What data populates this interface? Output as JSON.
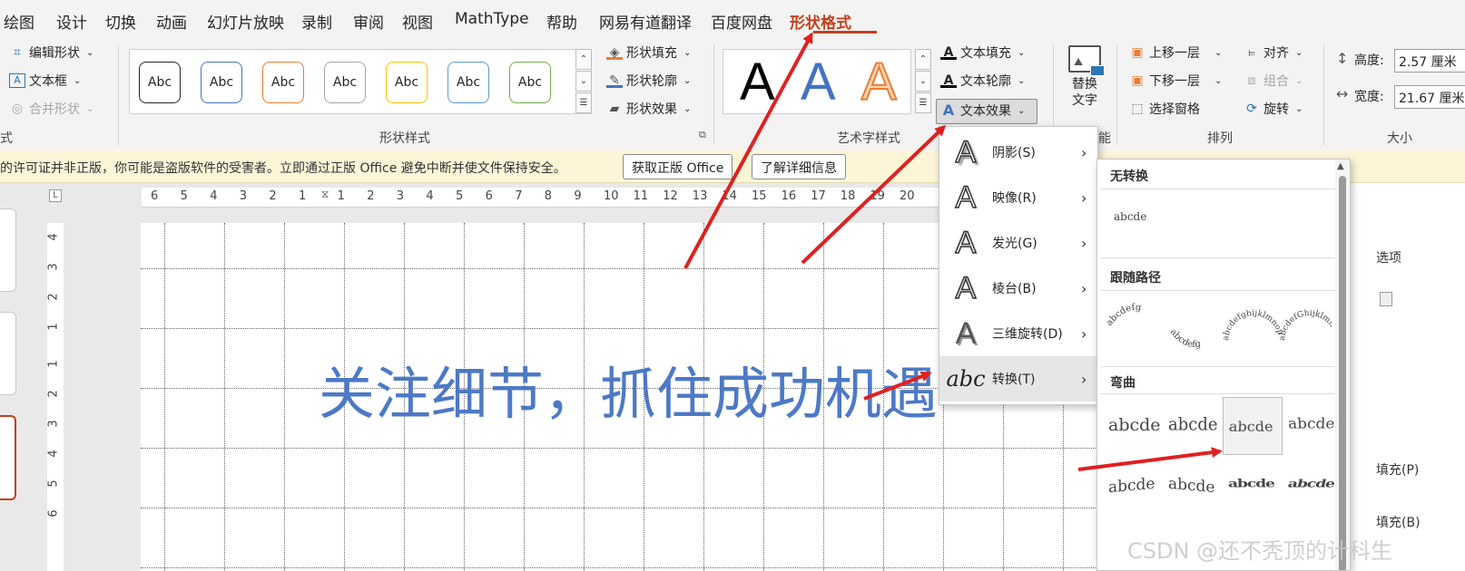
{
  "tabs": [
    "绘图",
    "设计",
    "切换",
    "动画",
    "幻灯片放映",
    "录制",
    "审阅",
    "视图",
    "MathType",
    "帮助",
    "网易有道翻译",
    "百度网盘",
    "形状格式"
  ],
  "active_tab": "形状格式",
  "ribbon": {
    "insert_shapes": {
      "edit_shape": "编辑形状",
      "text_box": "文本框",
      "merge_shapes": "合并形状",
      "group_label_partial": "式"
    },
    "shape_styles": {
      "gallery_items": [
        {
          "label": "Abc",
          "border_color": "#262626"
        },
        {
          "label": "Abc",
          "border_color": "#4472c4"
        },
        {
          "label": "Abc",
          "border_color": "#ed7d31"
        },
        {
          "label": "Abc",
          "border_color": "#a5a5a5"
        },
        {
          "label": "Abc",
          "border_color": "#ffc000"
        },
        {
          "label": "Abc",
          "border_color": "#5b9bd5"
        },
        {
          "label": "Abc",
          "border_color": "#70ad47"
        }
      ],
      "shape_fill": "形状填充",
      "shape_outline": "形状轮廓",
      "shape_effects": "形状效果",
      "group_label": "形状样式"
    },
    "wordart_styles": {
      "gallery": [
        "A",
        "A",
        "A"
      ],
      "text_fill": "文本填充",
      "text_outline": "文本轮廓",
      "text_effects": "文本效果",
      "group_label": "艺术字样式"
    },
    "accessibility": {
      "alt_text": [
        "替换",
        "文字"
      ],
      "group_label_partial": "能"
    },
    "arrange": {
      "bring_forward": "上移一层",
      "send_backward": "下移一层",
      "selection_pane": "选择窗格",
      "align": "对齐",
      "group": "组合",
      "rotate": "旋转",
      "group_label": "排列"
    },
    "size": {
      "height_label": "高度:",
      "height_value": "2.57 厘米",
      "width_label": "宽度:",
      "width_value": "21.67 厘米",
      "group_label": "大小"
    }
  },
  "infobar": {
    "message": "的许可证并非正版，你可能是盗版软件的受害者。立即通过正版 Office 避免中断并使文件保持安全。",
    "get_genuine": "获取正版 Office",
    "learn_more": "了解详细信息"
  },
  "ruler": {
    "h_ticks": [
      "6",
      "5",
      "4",
      "3",
      "2",
      "1",
      "1",
      "2",
      "3",
      "4",
      "5",
      "6",
      "7",
      "8",
      "9",
      "10",
      "11",
      "12",
      "13",
      "14",
      "15",
      "16",
      "17",
      "18",
      "19",
      "20"
    ],
    "v_ticks": [
      "4",
      "3",
      "2",
      "1",
      "1",
      "2",
      "3",
      "4",
      "5",
      "6"
    ]
  },
  "slide": {
    "text": "关注细节，抓住成功机遇"
  },
  "right_pane": {
    "options": "选项",
    "fill1": "填充(P)",
    "fill2": "填充(B)"
  },
  "effects_menu": [
    {
      "label": "阴影(S)",
      "icon": "shadow-A-icon"
    },
    {
      "label": "映像(R)",
      "icon": "reflection-A-icon"
    },
    {
      "label": "发光(G)",
      "icon": "glow-A-icon"
    },
    {
      "label": "棱台(B)",
      "icon": "bevel-A-icon"
    },
    {
      "label": "三维旋转(D)",
      "icon": "3d-rotation-A-icon"
    },
    {
      "label": "转换(T)",
      "icon": "transform-abc-icon"
    }
  ],
  "transform_menu": {
    "no_transform": "无转换",
    "no_transform_sample": "abcde",
    "follow_path": "跟随路径",
    "path_samples": [
      "abcdefg",
      "abcdefg",
      "abcdefghijklmnop",
      "abcdefGhijklmnop"
    ],
    "warp": "弯曲",
    "warp_samples": [
      "abcde",
      "abcde",
      "abcde",
      "abcde",
      "abcde",
      "abcde",
      "abcde",
      "abcde"
    ]
  },
  "watermark": "CSDN @还不秃顶的计科生"
}
